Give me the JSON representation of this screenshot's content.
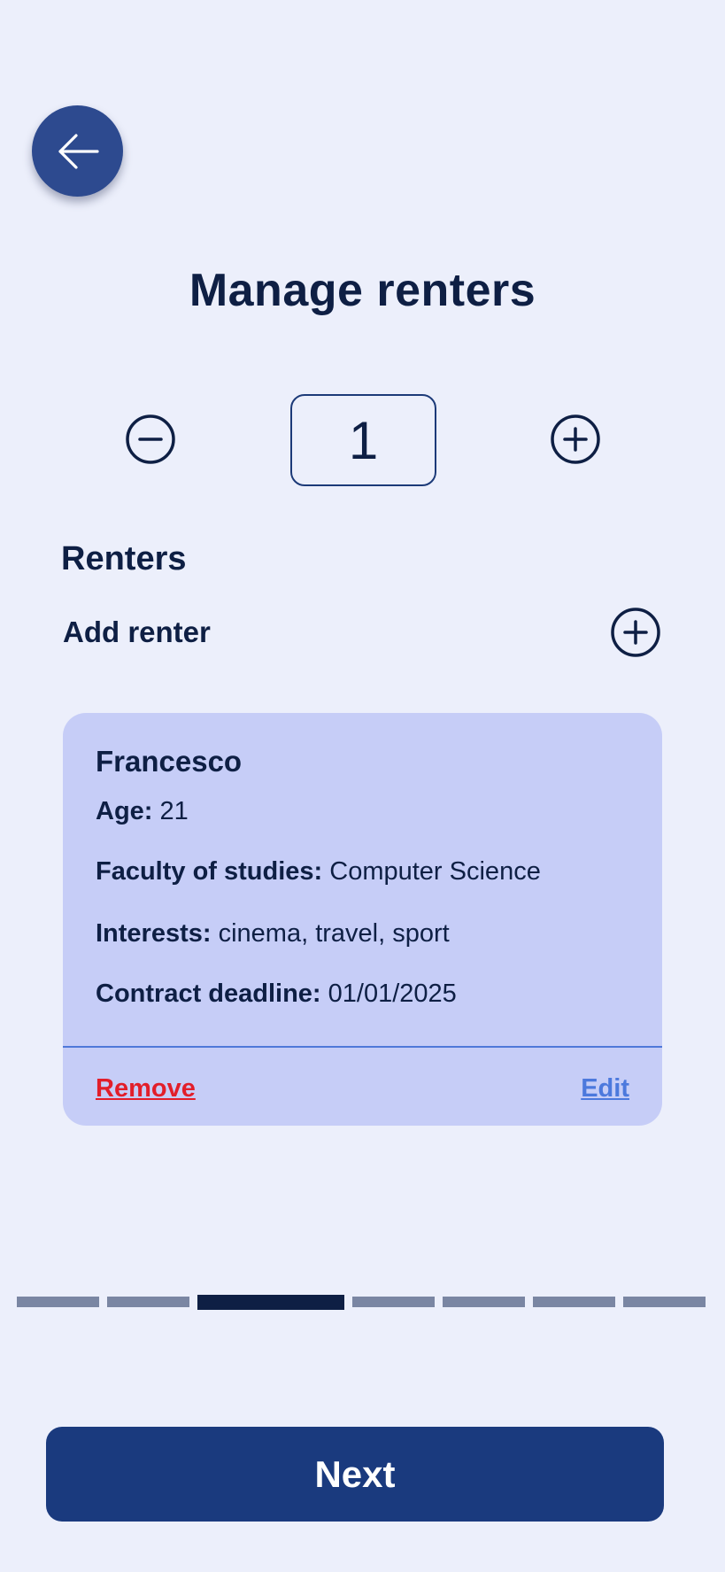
{
  "header": {
    "back_icon": "arrow-left-icon",
    "title": "Manage renters"
  },
  "stepper": {
    "minus_icon": "minus-circle-icon",
    "plus_icon": "plus-circle-icon",
    "value": "1"
  },
  "renters_section": {
    "title": "Renters",
    "add_label": "Add renter",
    "add_icon": "plus-circle-icon"
  },
  "renter_card": {
    "name": "Francesco",
    "age_label": "Age:",
    "age_value": "21",
    "faculty_label": "Faculty of studies:",
    "faculty_value": "Computer Science",
    "interests_label": "Interests:",
    "interests_value": "cinema, travel, sport",
    "deadline_label": "Contract deadline:",
    "deadline_value": "01/01/2025",
    "remove_label": "Remove",
    "edit_label": "Edit"
  },
  "progress": {
    "total_steps": 7,
    "current_step": 3
  },
  "footer": {
    "next_label": "Next"
  },
  "colors": {
    "background": "#eceffb",
    "primary": "#1a3a7e",
    "card": "#c6cdf7",
    "remove": "#e21e2a",
    "edit": "#4c79dd",
    "text": "#0e1f44"
  }
}
